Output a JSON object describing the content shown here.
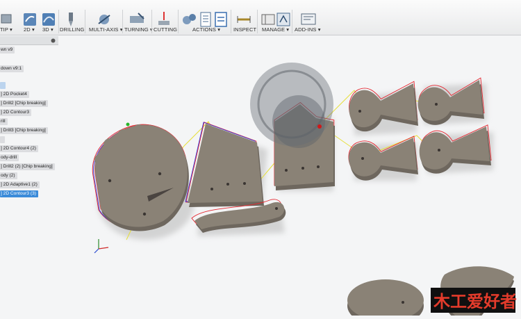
{
  "toolbar": {
    "groups": [
      {
        "label": "TIP ▾"
      },
      {
        "label": "2D ▾"
      },
      {
        "label": "3D ▾"
      },
      {
        "label": "DRILLING"
      },
      {
        "label": "MULTI-AXIS ▾"
      },
      {
        "label": "TURNING ▾"
      },
      {
        "label": "CUTTING"
      },
      {
        "label": "ACTIONS ▾"
      },
      {
        "label": "INSPECT"
      },
      {
        "label": "MANAGE ▾"
      },
      {
        "label": "ADD-INS ▾"
      }
    ]
  },
  "browser": {
    "items": [
      {
        "label": "wn v9"
      },
      {
        "label": "down v9:1"
      },
      {
        "label": ""
      },
      {
        "label": "] 2D Pocket4"
      },
      {
        "label": "] Drill2 [Chip breaking]"
      },
      {
        "label": "] 2D Contour3"
      },
      {
        "label": "rill"
      },
      {
        "label": "] Drill3 [Chip breaking]"
      },
      {
        "label": ""
      },
      {
        "label": "] 2D Contour4 (2)"
      },
      {
        "label": "ody-drill"
      },
      {
        "label": "] Drill2 (2) [Chip breaking]"
      },
      {
        "label": "ody (2)"
      },
      {
        "label": "] 2D Adaptive1 (2)"
      },
      {
        "label": "] 2D Contour3 (3)"
      }
    ]
  },
  "watermark": {
    "text": "木工爱好者"
  },
  "colors": {
    "part_fill": "#8a8276",
    "toolpath_red": "#e4262f",
    "toolpath_blue": "#3a3ad8",
    "rapid_yellow": "#e6df3a",
    "selected": "#3b8bd9"
  }
}
